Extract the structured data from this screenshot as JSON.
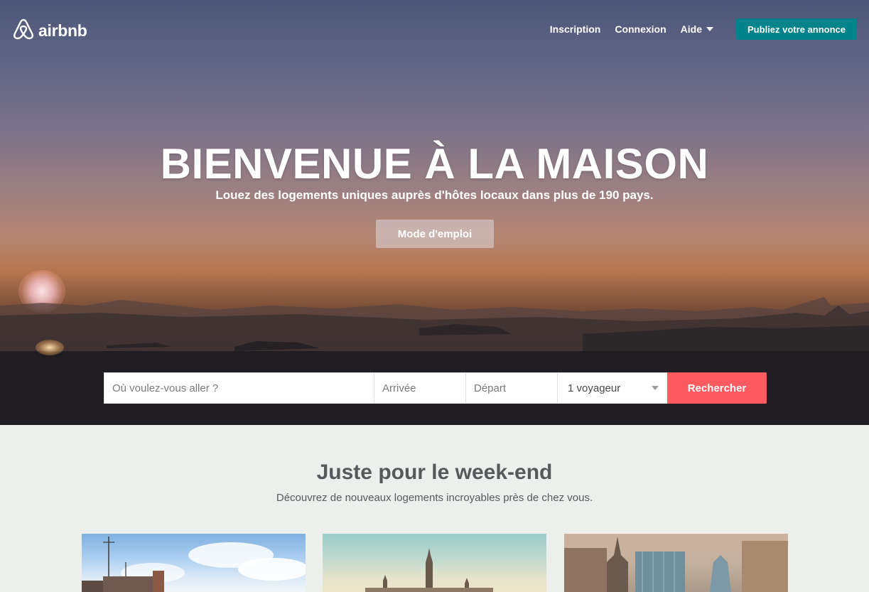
{
  "header": {
    "brand": "airbnb",
    "nav": {
      "signup": "Inscription",
      "login": "Connexion",
      "help": "Aide",
      "publish": "Publiez votre annonce"
    }
  },
  "hero": {
    "title": "BIENVENUE À LA MAISON",
    "subtitle": "Louez des logements uniques auprès d'hôtes locaux dans plus de 190 pays.",
    "how_it_works": "Mode d'emploi"
  },
  "search": {
    "where_placeholder": "Où voulez-vous aller ?",
    "checkin_placeholder": "Arrivée",
    "checkout_placeholder": "Départ",
    "guests": "1 voyageur",
    "submit": "Rechercher"
  },
  "weekend": {
    "title": "Juste pour le week-end",
    "subtitle": "Découvrez de nouveaux logements incroyables près de chez vous."
  },
  "colors": {
    "brand_teal": "#00838a",
    "search_red": "#ff5a5f",
    "section_bg": "#edefed"
  },
  "icons": {
    "logo": "airbnb-belo-icon",
    "help_caret": "chevron-down-icon",
    "guests_caret": "chevron-down-icon"
  }
}
